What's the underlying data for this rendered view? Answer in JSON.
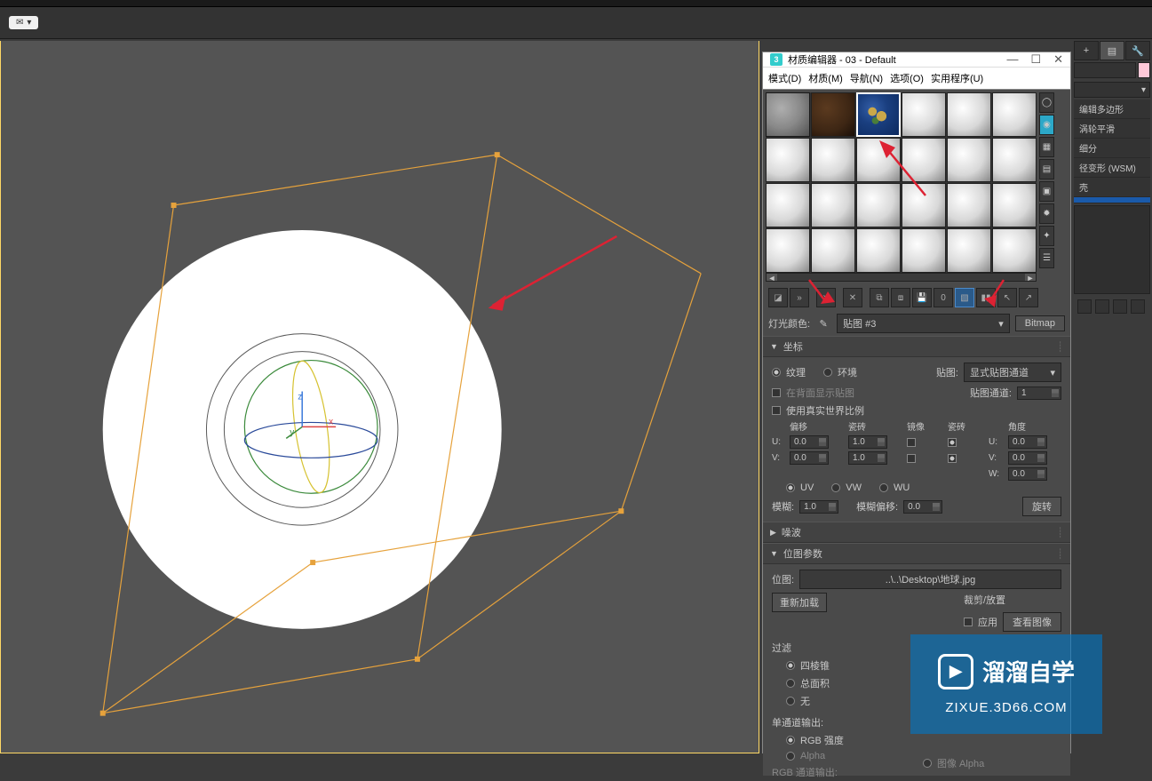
{
  "toolbar": {
    "pill": "▾"
  },
  "material_editor": {
    "title": "材质编辑器 - 03 - Default",
    "icon_label": "3",
    "menubar": [
      "模式(D)",
      "材质(M)",
      "导航(N)",
      "选项(O)",
      "实用程序(U)"
    ],
    "slots": [
      {
        "type": "stone"
      },
      {
        "type": "wood"
      },
      {
        "type": "earth",
        "selected": true
      },
      {
        "type": "default"
      },
      {
        "type": "default"
      },
      {
        "type": "default"
      },
      {
        "type": "default"
      },
      {
        "type": "default"
      },
      {
        "type": "default"
      },
      {
        "type": "default"
      },
      {
        "type": "default"
      },
      {
        "type": "default"
      },
      {
        "type": "default"
      },
      {
        "type": "default"
      },
      {
        "type": "default"
      },
      {
        "type": "default"
      },
      {
        "type": "default"
      },
      {
        "type": "default"
      },
      {
        "type": "default"
      },
      {
        "type": "default"
      },
      {
        "type": "default"
      },
      {
        "type": "default"
      },
      {
        "type": "default"
      },
      {
        "type": "default"
      }
    ],
    "light_color_label": "灯光颜色:",
    "map_name": "贴图 #3",
    "type_button": "Bitmap",
    "rollouts": {
      "coords": {
        "title": "坐标",
        "texture": "纹理",
        "environment": "环境",
        "map_label": "贴图:",
        "map_dropdown": "显式贴图通道",
        "show_back": "在背面显示贴图",
        "map_channel_label": "贴图通道:",
        "map_channel_value": "1",
        "real_world": "使用真实世界比例",
        "headers": {
          "offset": "偏移",
          "tiling": "瓷砖",
          "mirror": "镜像",
          "tile": "瓷砖",
          "angle": "角度"
        },
        "u_label": "U:",
        "v_label": "V:",
        "w_label": "W:",
        "u_offset": "0.0",
        "u_tiling": "1.0",
        "u_angle": "0.0",
        "v_offset": "0.0",
        "v_tiling": "1.0",
        "v_angle": "0.0",
        "w_angle": "0.0",
        "uv": "UV",
        "vw": "VW",
        "wu": "WU",
        "blur_label": "模糊:",
        "blur_value": "1.0",
        "blur_offset_label": "模糊偏移:",
        "blur_offset_value": "0.0",
        "rotate_button": "旋转"
      },
      "noise": {
        "title": "噪波"
      },
      "bitmap_params": {
        "title": "位图参数",
        "bitmap_label": "位图:",
        "bitmap_path": "..\\..\\Desktop\\地球.jpg",
        "reload": "重新加载",
        "crop_place": "裁剪/放置",
        "apply": "应用",
        "view_image": "查看图像",
        "filter_label": "过滤",
        "filter_pyramidal": "四棱锥",
        "filter_sum_area": "总面积",
        "filter_none": "无",
        "mono_out_label": "单通道输出:",
        "mono_rgb": "RGB 强度",
        "mono_alpha": "Alpha",
        "rgb_out_label": "RGB 通道输出:",
        "image_alpha": "图像 Alpha"
      }
    }
  },
  "right_panel": {
    "modifiers": [
      "编辑多边形",
      "涡轮平滑",
      "细分",
      "径变形 (WSM)",
      "壳"
    ],
    "selected_mod": ""
  },
  "watermark": {
    "title": "溜溜自学",
    "url": "ZIXUE.3D66.COM"
  }
}
